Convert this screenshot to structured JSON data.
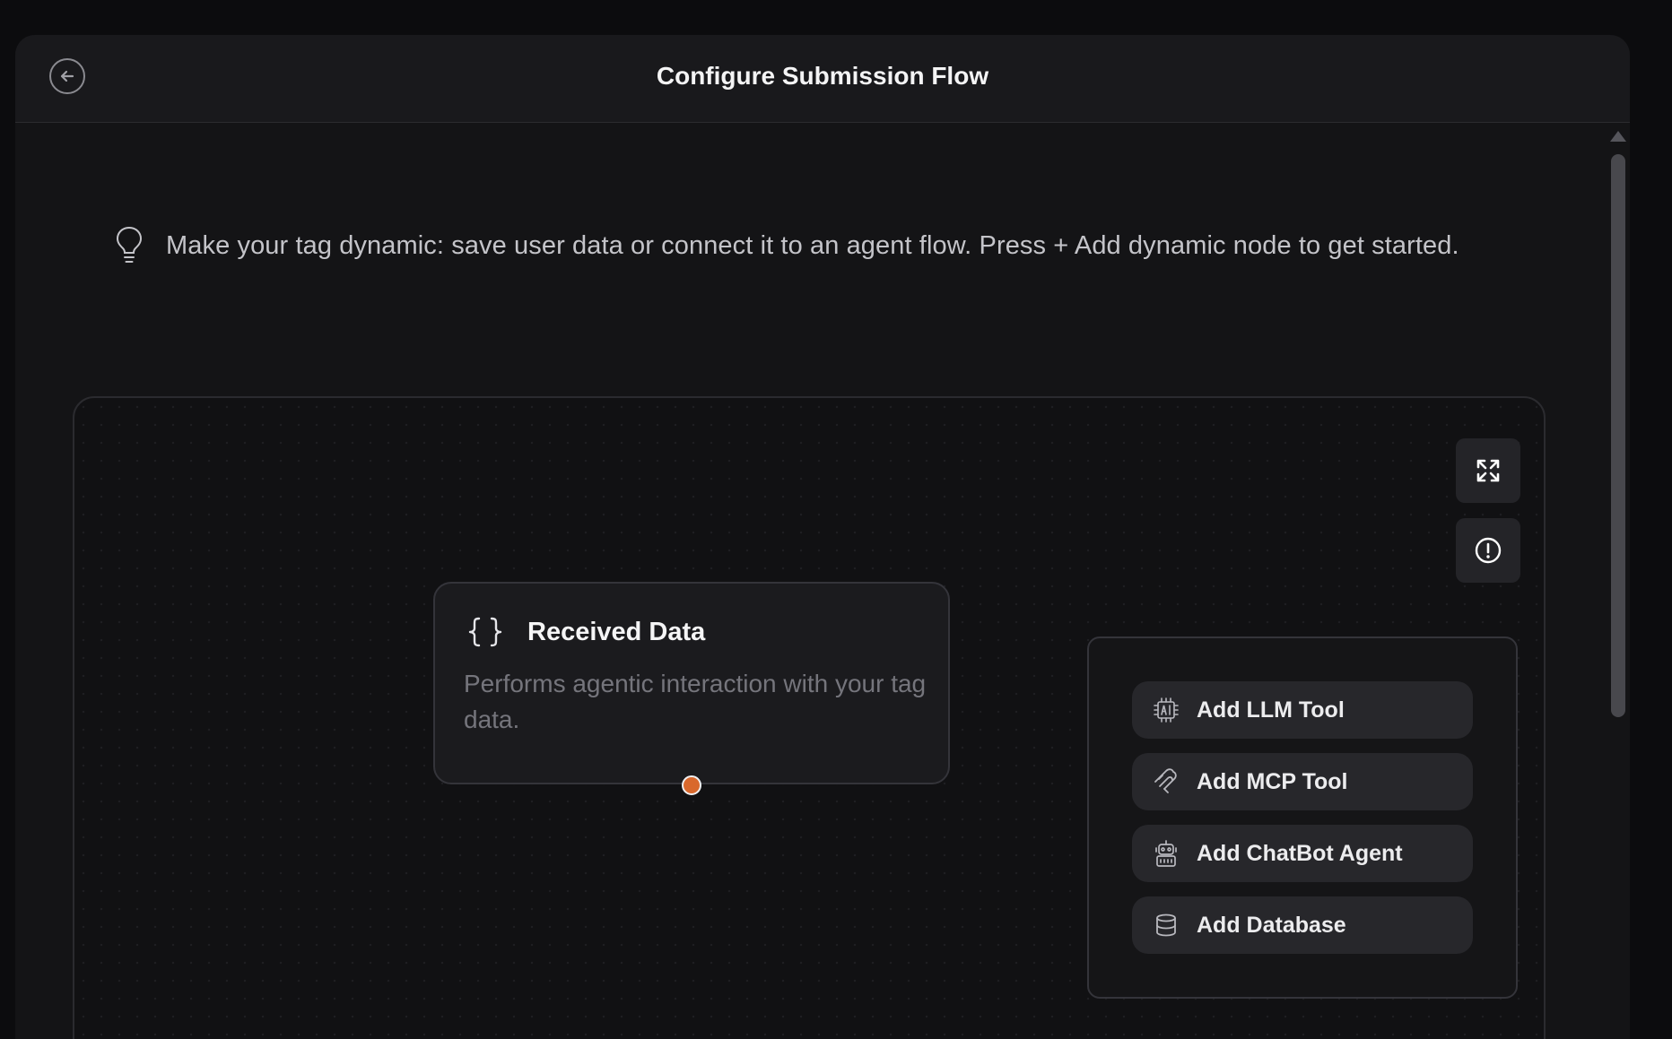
{
  "header": {
    "title": "Configure Submission Flow",
    "back_icon": "arrow-left-circle-icon"
  },
  "tip": {
    "icon": "lightbulb-icon",
    "text": "Make your tag dynamic: save user data or connect it to an agent flow. Press + Add dynamic node to get started."
  },
  "canvas": {
    "controls": [
      {
        "name": "fullscreen",
        "icon": "expand-icon"
      },
      {
        "name": "info",
        "icon": "info-circle-icon"
      }
    ],
    "node": {
      "icon": "curly-braces-icon",
      "title": "Received Data",
      "description": "Performs agentic interaction with your tag data.",
      "handle_color": "#d9682c"
    },
    "add_menu": {
      "items": [
        {
          "label": "Add LLM Tool",
          "icon": "ai-chip-icon"
        },
        {
          "label": "Add MCP Tool",
          "icon": "mcp-icon"
        },
        {
          "label": "Add ChatBot Agent",
          "icon": "robot-icon"
        },
        {
          "label": "Add Database",
          "icon": "database-icon"
        }
      ]
    }
  }
}
